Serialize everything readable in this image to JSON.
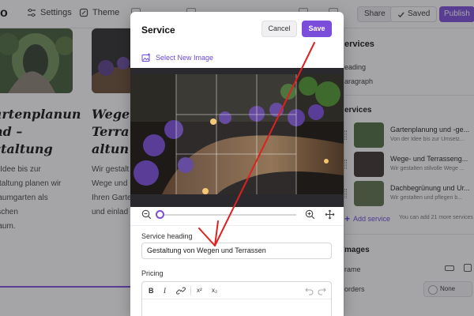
{
  "topbar": {
    "logo": "o",
    "settings_label": "Settings",
    "theme_label": "Theme",
    "share_label": "Share",
    "saved_label": "Saved",
    "publish_label": "Publish"
  },
  "canvas": {
    "card1_title": "artenplanun\nnd –\nstaltung",
    "card1_text": "r Idee bis zur\nstaltung planen wir\nraumgarten als\nischen\nraum.",
    "card2_title": "Wege\nTerra\naltun",
    "card2_text": "Wir gestalt\nWege und \nIhren Garte\nund einlad"
  },
  "right_panel": {
    "section_label": "ervices",
    "heading_item": "eading",
    "paragraph_item": "aragraph",
    "services_label": "ervices",
    "services": [
      {
        "title": "Gartenplanung und -ge...",
        "subtitle": "Von der Idee bis zur Umsetz..."
      },
      {
        "title": "Wege- und Terrasseng...",
        "subtitle": "Wir gestalten stilvolle Wege ..."
      },
      {
        "title": "Dachbegrünung und Ur...",
        "subtitle": "Wir gestalten und pflegen b..."
      }
    ],
    "add_service_label": "Add service",
    "add_service_note": "You can add 21 more services",
    "images_label": "mages",
    "frame_label": "rame",
    "borders_label": "orders",
    "borders_value": "None"
  },
  "modal": {
    "title": "Service",
    "cancel_label": "Cancel",
    "save_label": "Save",
    "select_image_label": "Select New Image",
    "heading_label": "Service heading",
    "heading_value": "Gestaltung von Wegen und Terrassen",
    "pricing_label": "Pricing",
    "zoom_level": 0.0,
    "toolbar": {
      "bold": "B",
      "italic": "I",
      "link_icon": "link-icon",
      "superscript": "x²",
      "subscript": "x₂",
      "undo_icon": "undo-icon",
      "redo_icon": "redo-icon"
    }
  },
  "colors": {
    "accent": "#7b4ddb",
    "annotation": "#e02020"
  }
}
